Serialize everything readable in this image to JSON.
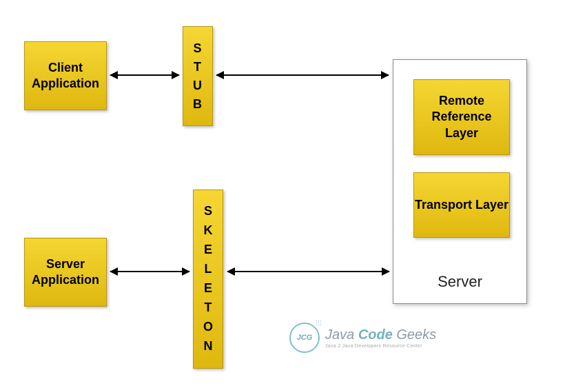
{
  "boxes": {
    "client": "Client Application",
    "stub": "STUB",
    "server_app": "Server Application",
    "skeleton": "SKELETON",
    "rrl": "Remote Reference Layer",
    "transport": "Transport Layer",
    "server_label": "Server"
  },
  "logo": {
    "badge": "JCG",
    "word1": "Java",
    "word2": "Code",
    "word3": "Geeks",
    "subtitle": "Java 2 Java Developers Resource Center"
  }
}
